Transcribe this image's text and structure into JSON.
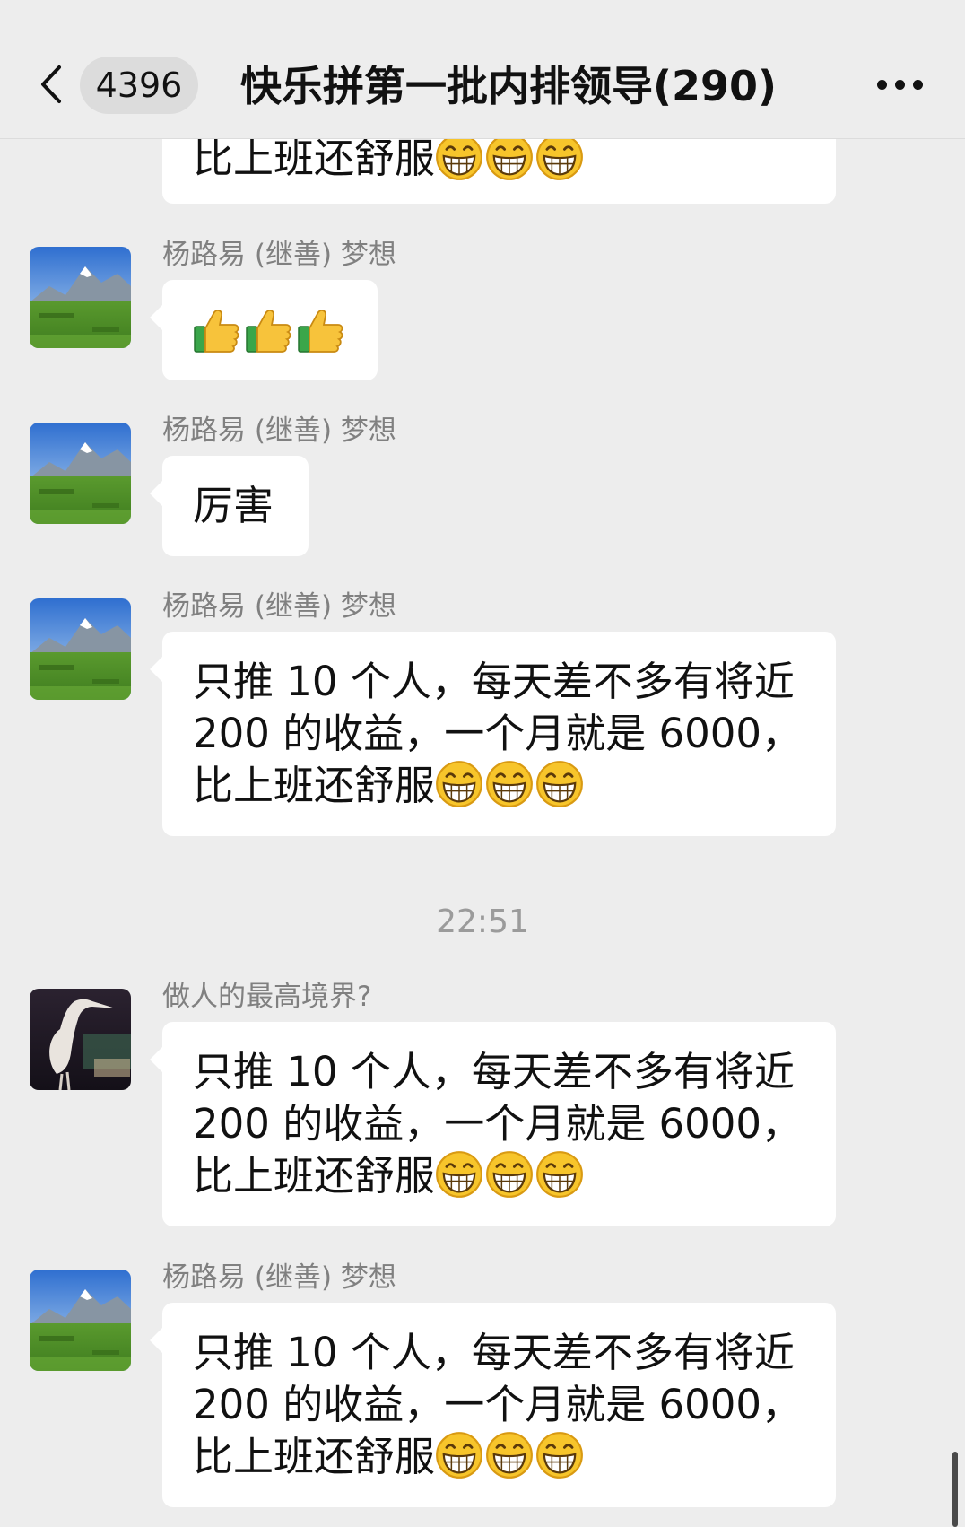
{
  "header": {
    "unread_count": "4396",
    "title": "快乐拼第一批内排领导(290)"
  },
  "messages": [
    {
      "text": "比上班还舒服",
      "emoji": [
        "grin-emoji",
        "grin-emoji",
        "grin-emoji"
      ]
    },
    {
      "sender": "杨路易 (继善) 梦想",
      "emoji": [
        "thumbs-up-emoji",
        "thumbs-up-emoji",
        "thumbs-up-emoji"
      ]
    },
    {
      "sender": "杨路易 (继善) 梦想",
      "text": "厉害"
    },
    {
      "sender": "杨路易 (继善) 梦想",
      "text": "只推 10 个人，每天差不多有将近\n200 的收益，一个月就是 6000，\n比上班还舒服",
      "emoji": [
        "grin-emoji",
        "grin-emoji",
        "grin-emoji"
      ]
    },
    {
      "sender": "做人的最高境界?",
      "text": "只推 10 个人，每天差不多有将近\n200 的收益，一个月就是 6000，\n比上班还舒服",
      "emoji": [
        "grin-emoji",
        "grin-emoji",
        "grin-emoji"
      ]
    },
    {
      "sender": "杨路易 (继善) 梦想",
      "text": "只推 10 个人，每天差不多有将近\n200 的收益，一个月就是 6000，\n比上班还舒服",
      "emoji": [
        "grin-emoji",
        "grin-emoji",
        "grin-emoji"
      ]
    }
  ],
  "time_separator": "22:51",
  "colors": {
    "background": "#ededed",
    "bubble": "#ffffff",
    "name_text": "#808080",
    "badge": "#dcdcdc"
  }
}
